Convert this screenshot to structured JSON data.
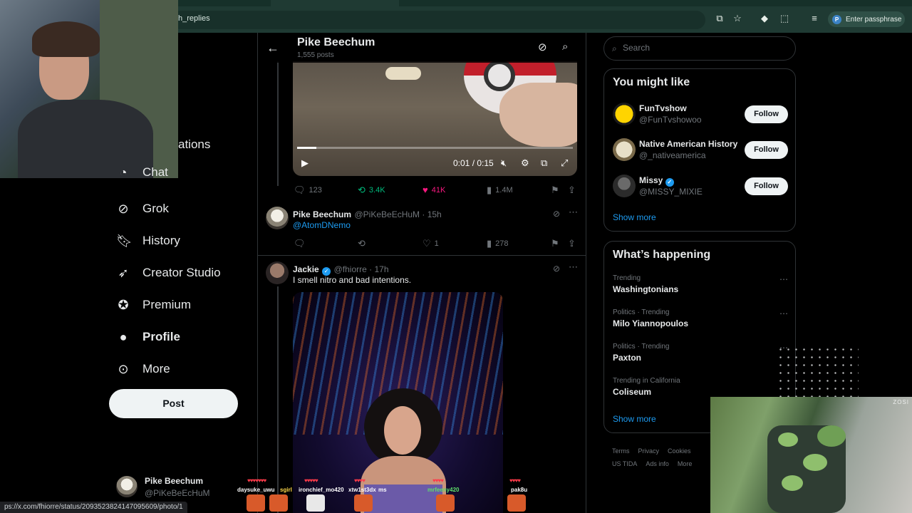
{
  "browser": {
    "address_text": "h_replies",
    "profile_chip": "Enter passphrase",
    "profile_initial": "P"
  },
  "nav": {
    "partial_item_1": "ations",
    "partial_item_2": "Chat",
    "items": [
      {
        "label": "Grok",
        "icon": "grok-icon"
      },
      {
        "label": "History",
        "icon": "bookmark-icon"
      },
      {
        "label": "Creator Studio",
        "icon": "rocket-icon"
      },
      {
        "label": "Premium",
        "icon": "verified-badge-icon"
      },
      {
        "label": "Profile",
        "icon": "person-icon"
      },
      {
        "label": "More",
        "icon": "more-circle-icon"
      }
    ],
    "post_label": "Post",
    "account": {
      "name": "Pike Beechum",
      "handle": "@PiKeBeEcHuM"
    }
  },
  "timeline": {
    "title": "Pike Beechum",
    "subtitle": "1,555 posts",
    "video": {
      "time": "0:01 / 0:15",
      "progress": 0.07
    },
    "video_actions": {
      "replies": "123",
      "reposts": "3.4K",
      "likes": "41K",
      "views": "1.4M"
    },
    "reply": {
      "name": "Pike Beechum",
      "handle_time": "@PiKeBeEcHuM · 15h",
      "mention": "@AtomDNemo",
      "replies": "",
      "reposts": "",
      "likes": "1",
      "views": "278"
    },
    "tweet": {
      "name": "Jackie",
      "handle_time": "@fhiorre · 17h",
      "text": "I smell nitro and bad intentions."
    }
  },
  "right": {
    "search_placeholder": "Search",
    "wtf_title": "You might like",
    "wtf": [
      {
        "name": "FunTvshow",
        "handle": "@FunTvshowoo",
        "verified": false,
        "follow": "Follow"
      },
      {
        "name": "Native American History",
        "handle": "@_nativeamerica",
        "verified": false,
        "follow": "Follow"
      },
      {
        "name": "Missy",
        "handle": "@MISSY_MIXIE",
        "verified": true,
        "follow": "Follow"
      }
    ],
    "wtf_show_more": "Show more",
    "trends_title": "What’s happening",
    "trends": [
      {
        "category": "Trending",
        "name": "Washingtonians"
      },
      {
        "category": "Politics · Trending",
        "name": "Milo Yiannopoulos"
      },
      {
        "category": "Politics · Trending",
        "name": "Paxton"
      },
      {
        "category": "Trending in California",
        "name": "Coliseum"
      }
    ],
    "trends_show_more": "Show more",
    "footer": {
      "terms": "Terms",
      "privacy": "Privacy",
      "cookies": "Cookies",
      "tos": "US TIDA",
      "ads": "Ads info",
      "more": "More"
    }
  },
  "status_url": "ps://x.com/fhiorre/status/2093523824147095609/photo/1",
  "overlay": {
    "cam_stamp": "ZOSI",
    "chat_users": [
      "daysuke_uwu",
      "sgirl",
      "ironchief_mo420",
      "xtw1st3dx",
      "ms",
      "mrfeeny420",
      "pak8u"
    ]
  }
}
